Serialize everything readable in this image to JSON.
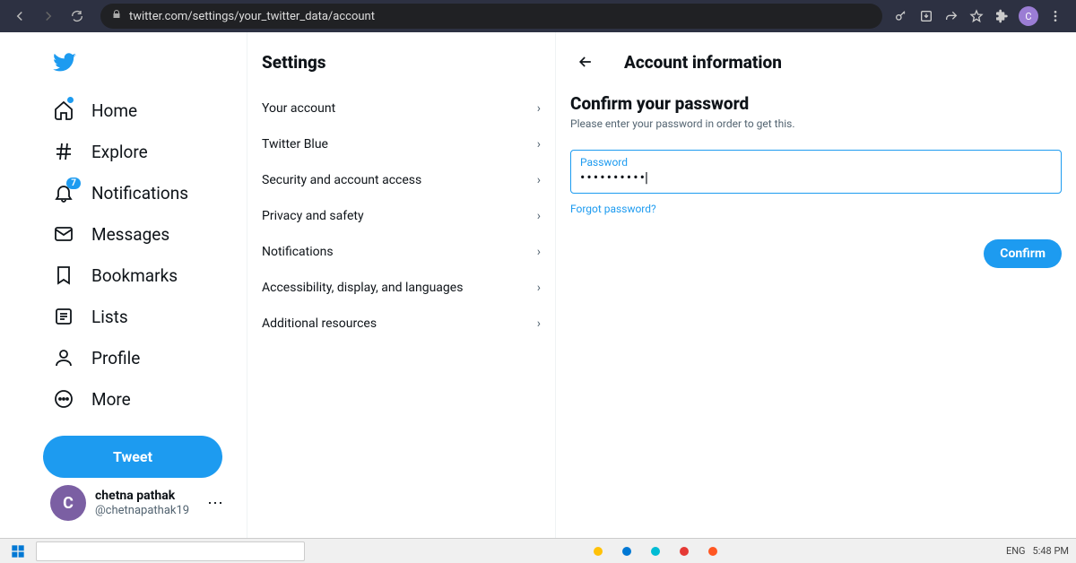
{
  "browser": {
    "url": "twitter.com/settings/your_twitter_data/account",
    "profile_initial": "C"
  },
  "sidebar": {
    "items": [
      {
        "label": "Home"
      },
      {
        "label": "Explore"
      },
      {
        "label": "Notifications",
        "badge": "7"
      },
      {
        "label": "Messages"
      },
      {
        "label": "Bookmarks"
      },
      {
        "label": "Lists"
      },
      {
        "label": "Profile"
      },
      {
        "label": "More"
      }
    ],
    "tweet_label": "Tweet"
  },
  "user": {
    "name": "chetna pathak",
    "handle": "@chetnapathak19",
    "avatar_initial": "C"
  },
  "settings": {
    "title": "Settings",
    "items": [
      "Your account",
      "Twitter Blue",
      "Security and account access",
      "Privacy and safety",
      "Notifications",
      "Accessibility, display, and languages",
      "Additional resources"
    ]
  },
  "detail": {
    "header_title": "Account information",
    "confirm_title": "Confirm your password",
    "confirm_sub": "Please enter your password in order to get this.",
    "password_label": "Password",
    "password_value": "••••••••••",
    "forgot_label": "Forgot password?",
    "confirm_button": "Confirm"
  },
  "taskbar": {
    "lang": "ENG",
    "time": "5:48 PM"
  }
}
